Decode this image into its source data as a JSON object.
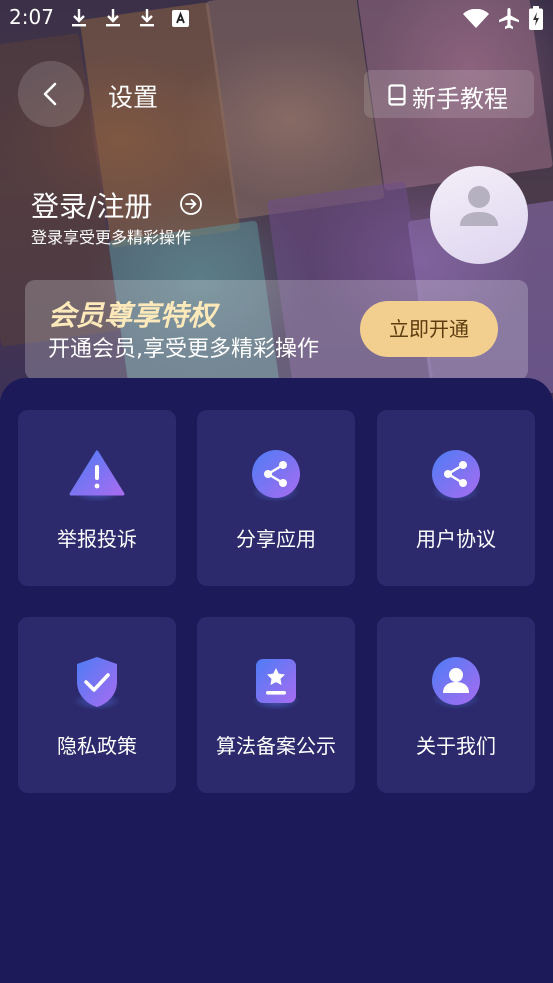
{
  "status_bar": {
    "time": "2:07",
    "left_icons": [
      "download-icon",
      "download-icon",
      "download-icon",
      "font-a-icon"
    ],
    "right_icons": [
      "wifi-icon",
      "airplane-icon",
      "battery-charging-icon"
    ]
  },
  "header": {
    "title": "设置",
    "tutorial_label": "新手教程"
  },
  "profile": {
    "login_title": "登录/注册",
    "login_subtitle": "登录享受更多精彩操作"
  },
  "vip": {
    "title": "会员尊享特权",
    "subtitle": "开通会员,享受更多精彩操作",
    "button_label": "立即开通"
  },
  "menu": {
    "items": [
      {
        "label": "举报投诉",
        "icon": "warning-icon"
      },
      {
        "label": "分享应用",
        "icon": "share-icon"
      },
      {
        "label": "用户协议",
        "icon": "share-icon"
      },
      {
        "label": "隐私政策",
        "icon": "shield-check-icon"
      },
      {
        "label": "算法备案公示",
        "icon": "badge-star-icon"
      },
      {
        "label": "关于我们",
        "icon": "user-circle-icon"
      }
    ]
  },
  "colors": {
    "background": "#1c1a58",
    "tile": "#2c2a6c",
    "vip_title": "#fde9b9",
    "vip_button": "#f2cf8f",
    "icon_blue": "#4d7cf5",
    "icon_purple": "#a86cf0"
  }
}
